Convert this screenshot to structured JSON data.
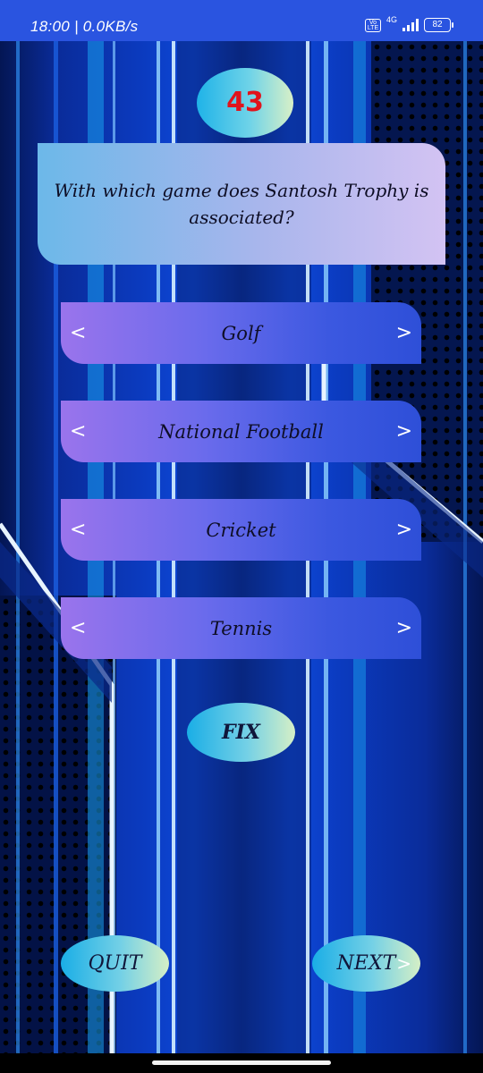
{
  "status_bar": {
    "time_speed": "18:00 | 0.0KB/s",
    "volte_label": "Vo LTE",
    "network_type": "4G",
    "battery_level": "82"
  },
  "quiz": {
    "question_number": "43",
    "question_text": "With which game does Santosh Trophy is associated?",
    "options": [
      {
        "label": "Golf"
      },
      {
        "label": "National Football"
      },
      {
        "label": "Cricket"
      },
      {
        "label": "Tennis"
      }
    ],
    "arrow_left_glyph": "<",
    "arrow_right_glyph": ">"
  },
  "buttons": {
    "fix_label": "FIX",
    "quit_label": "QUIT",
    "next_label": "NEXT",
    "next_arrow_glyph": ">"
  },
  "colors": {
    "status_bar": "#2a54e0",
    "question_number_text": "#e0141c",
    "option_gradient_start": "#9a74ec",
    "option_gradient_end": "#2e4fd8",
    "oval_gradient_start": "#1aaee6",
    "oval_gradient_end": "#d5efc6"
  }
}
